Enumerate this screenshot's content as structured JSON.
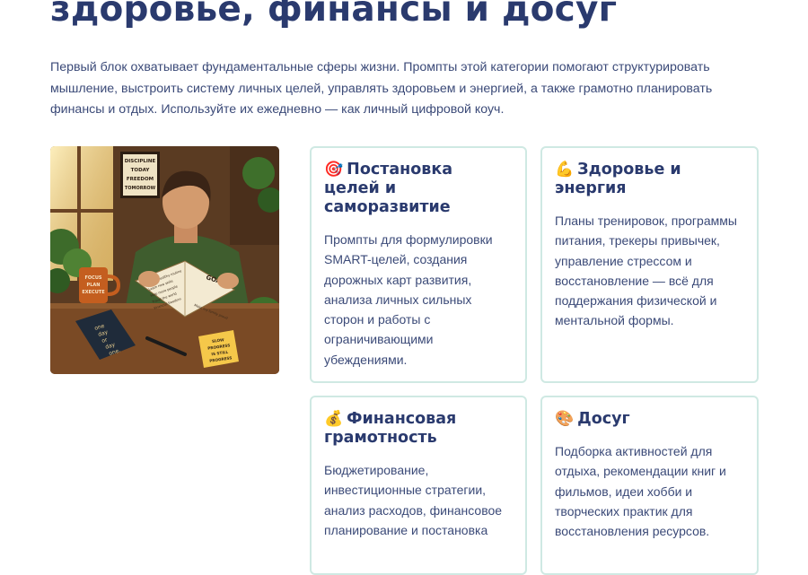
{
  "heading": "здоровье, финансы и досуг",
  "intro": "Первый блок охватывает фундаментальные сферы жизни. Промпты этой категории помогают структурировать мышление, выстроить систему личных целей, управлять здоровьем и энергией, а также грамотно планировать финансы и отдых. Используйте их ежедневно — как личный цифровой коуч.",
  "illustration": {
    "poster": [
      "DISCIPLINE",
      "TODAY",
      "FREEDOM",
      "TOMORROW"
    ],
    "notebook_title": "GOALS",
    "notebook_items": [
      "Build a healthy routine",
      "Learn new skills",
      "Help more people",
      "Travel the world",
      "Financial freedom",
      "Make my family proud"
    ],
    "mug_text": [
      "FOCUS",
      "PLAN",
      "EXECUTE"
    ],
    "book_text": [
      "one",
      "day",
      "or",
      "day",
      "one."
    ],
    "sticky_note": [
      "SLOW",
      "PROGRESS",
      "IS STILL",
      "PROGRESS"
    ]
  },
  "cards": [
    {
      "icon": "target-icon",
      "emoji": "🎯",
      "title": "Постановка целей и саморазвитие",
      "text": "Промпты для формулировки SMART-целей, создания дорожных карт развития, анализа личных сильных сторон и работы с ограничивающими убеждениями."
    },
    {
      "icon": "flexed-biceps-icon",
      "emoji": "💪",
      "title": "Здоровье и энергия",
      "text": "Планы тренировок, программы питания, трекеры привычек, управление стрессом и восстановление — всё для поддержания физической и ментальной формы."
    },
    {
      "icon": "money-bag-icon",
      "emoji": "💰",
      "title": "Финансовая грамотность",
      "text": "Бюджетирование, инвестиционные стратегии, анализ расходов, финансовое планирование и постановка"
    },
    {
      "icon": "palette-icon",
      "emoji": "🎨",
      "title": "Досуг",
      "text": "Подборка активностей для отдыха, рекомендации книг и фильмов, идеи хобби и творческих практик для восстановления ресурсов."
    }
  ]
}
